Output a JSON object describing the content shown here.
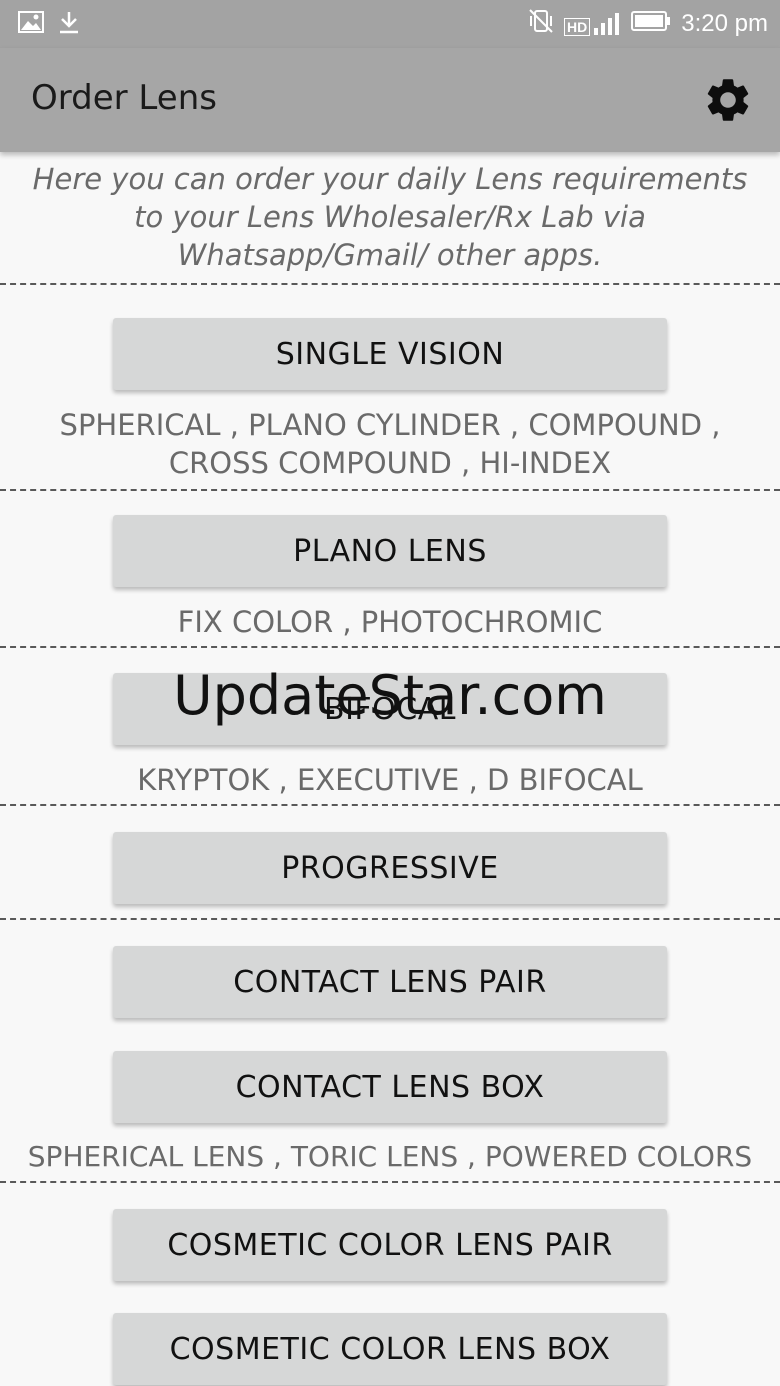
{
  "status_bar": {
    "time": "3:20 pm",
    "icons": [
      "gallery-icon",
      "download-icon",
      "vibrate-icon",
      "hd-signal-icon",
      "battery-icon"
    ],
    "hd_label": "HD"
  },
  "app_bar": {
    "title": "Order Lens",
    "settings_icon": "gear-icon"
  },
  "intro": {
    "text": "Here you can order your daily Lens requirements to your Lens Wholesaler/Rx Lab via Whatsapp/Gmail/ other apps."
  },
  "sections": {
    "single_vision": {
      "label": "SINGLE VISION",
      "description": "SPHERICAL , PLANO CYLINDER , COMPOUND , CROSS COMPOUND , HI-INDEX"
    },
    "plano_lens": {
      "label": "PLANO LENS",
      "description": "FIX COLOR , PHOTOCHROMIC"
    },
    "bifocal": {
      "label": "BIFOCAL",
      "description": "KRYPTOK , EXECUTIVE , D BIFOCAL"
    },
    "progressive": {
      "label": "PROGRESSIVE"
    },
    "contact_lens": {
      "pair_label": "CONTACT LENS PAIR",
      "box_label": "CONTACT LENS BOX",
      "description": "SPHERICAL LENS , TORIC LENS , POWERED COLORS"
    },
    "cosmetic": {
      "pair_label": "COSMETIC COLOR LENS PAIR",
      "box_label": "COSMETIC COLOR LENS BOX"
    }
  },
  "watermark": "UpdateStar.com"
}
